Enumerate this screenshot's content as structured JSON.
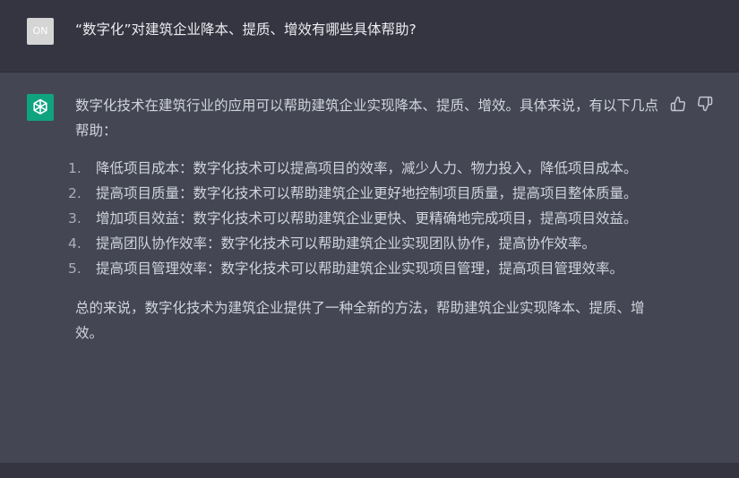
{
  "user": {
    "avatar_label": "ON",
    "question": "“数字化”对建筑企业降本、提质、增效有哪些具体帮助?"
  },
  "assistant": {
    "intro": "数字化技术在建筑行业的应用可以帮助建筑企业实现降本、提质、增效。具体来说，有以下几点帮助：",
    "points": [
      {
        "num": "1.",
        "text": "降低项目成本：数字化技术可以提高项目的效率，减少人力、物力投入，降低项目成本。"
      },
      {
        "num": "2.",
        "text": "提高项目质量：数字化技术可以帮助建筑企业更好地控制项目质量，提高项目整体质量。"
      },
      {
        "num": "3.",
        "text": "增加项目效益：数字化技术可以帮助建筑企业更快、更精确地完成项目，提高项目效益。"
      },
      {
        "num": "4.",
        "text": "提高团队协作效率：数字化技术可以帮助建筑企业实现团队协作，提高协作效率。"
      },
      {
        "num": "5.",
        "text": "提高项目管理效率：数字化技术可以帮助建筑企业实现项目管理，提高项目管理效率。"
      }
    ],
    "summary": "总的来说，数字化技术为建筑企业提供了一种全新的方法，帮助建筑企业实现降本、提质、增效。"
  },
  "icons": {
    "assistant_avatar": "openai-logo-icon",
    "thumbs_up": "thumbs-up-icon",
    "thumbs_down": "thumbs-down-icon"
  },
  "colors": {
    "page_bg": "#343541",
    "assistant_bg": "#444654",
    "avatar_green": "#10a37f",
    "text": "#d1d5db"
  }
}
